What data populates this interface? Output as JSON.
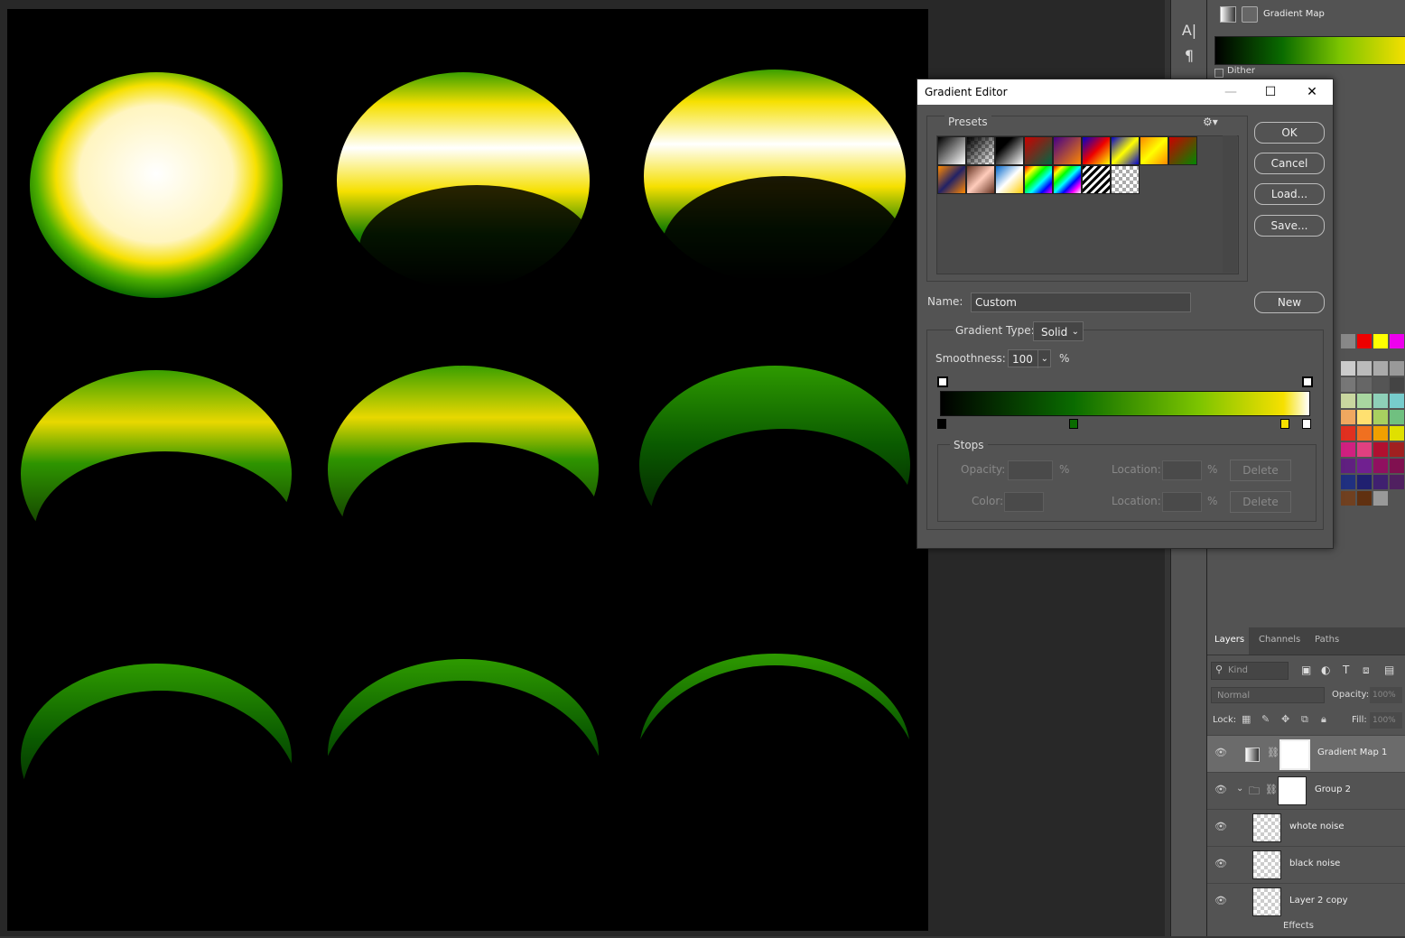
{
  "gradient_editor": {
    "title": "Gradient Editor",
    "presets_label": "Presets",
    "buttons": {
      "ok": "OK",
      "cancel": "Cancel",
      "load": "Load...",
      "save": "Save...",
      "new": "New"
    },
    "name_label": "Name:",
    "name_value": "Custom",
    "gradient_type_label": "Gradient Type:",
    "gradient_type_value": "Solid",
    "smoothness_label": "Smoothness:",
    "smoothness_value": "100",
    "percent": "%",
    "stops": {
      "label": "Stops",
      "opacity_label": "Opacity:",
      "color_label": "Color:",
      "location_label": "Location:",
      "delete_label": "Delete"
    },
    "color_stops": [
      "#000000",
      "#0a6b00",
      "#f6e000",
      "#ffffff"
    ]
  },
  "properties": {
    "title": "Gradient Map",
    "dither_label": "Dither"
  },
  "layers": {
    "tabs": [
      "Layers",
      "Channels",
      "Paths"
    ],
    "kind_placeholder": "Kind",
    "blend_mode": "Normal",
    "opacity_label": "Opacity:",
    "opacity_value": "100%",
    "lock_label": "Lock:",
    "fill_label": "Fill:",
    "fill_value": "100%",
    "items": [
      {
        "name": "Gradient Map 1"
      },
      {
        "name": "Group 2"
      },
      {
        "name": "whote noise"
      },
      {
        "name": "black noise"
      },
      {
        "name": "Layer 2 copy"
      }
    ],
    "effects_label": "Effects"
  },
  "colors": {
    "accent_green": "#0a6b00",
    "accent_yellow": "#f6e000"
  }
}
